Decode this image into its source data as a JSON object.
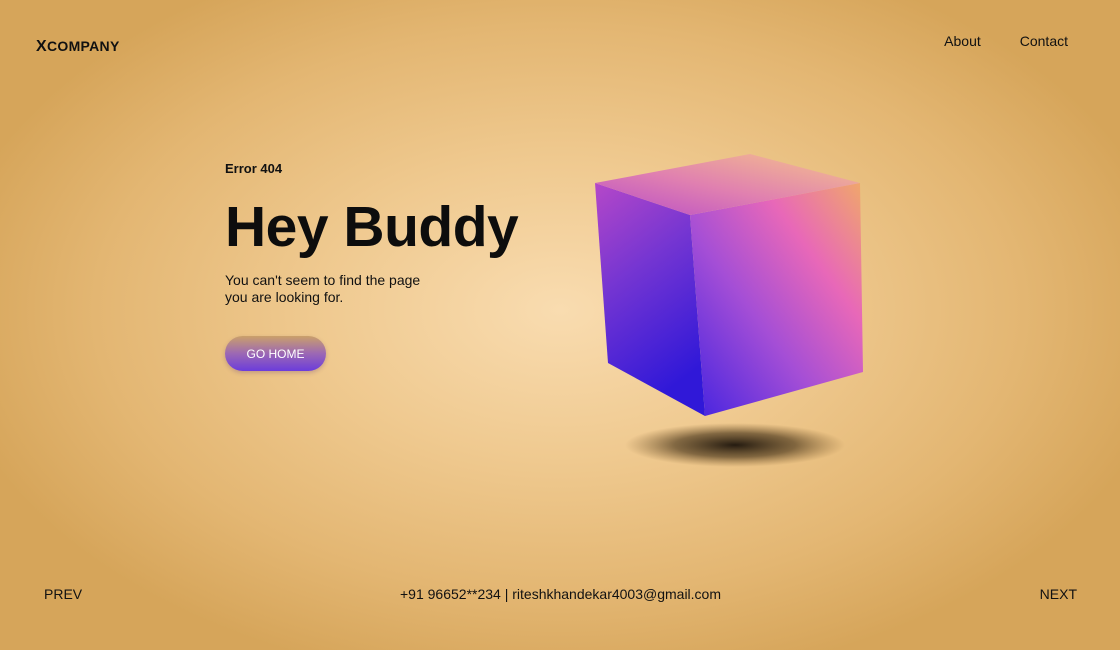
{
  "header": {
    "logo_first": "X",
    "logo_rest": "COMPANY",
    "nav": [
      {
        "label": "About"
      },
      {
        "label": "Contact"
      }
    ]
  },
  "hero": {
    "eyebrow": "Error 404",
    "headline": "Hey Buddy",
    "description": "You can't seem to find the page you are looking for.",
    "button_label": "GO HOME"
  },
  "footer": {
    "prev_label": "PREV",
    "contact": "+91 96652**234 | riteshkhandekar4003@gmail.com",
    "next_label": "NEXT"
  },
  "colors": {
    "background": "#efc98f",
    "button_start": "#caa06a",
    "button_end": "#6b3cdb",
    "cube_pink": "#d24fd0",
    "cube_blue": "#3a1bdc",
    "cube_top": "#f0b47a"
  }
}
